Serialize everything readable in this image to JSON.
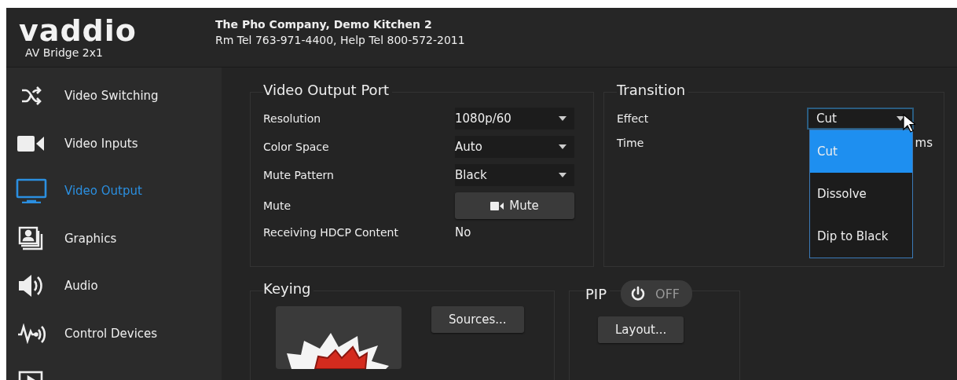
{
  "header": {
    "logo": "vaddio",
    "model": "AV Bridge 2x1",
    "info": [
      "The Pho Company, Demo Kitchen 2",
      "Rm Tel 763-971-4400, Help Tel 800-572-2011"
    ]
  },
  "sidebar": {
    "items": [
      {
        "label": "Video Switching",
        "selected": false
      },
      {
        "label": "Video Inputs",
        "selected": false
      },
      {
        "label": "Video Output",
        "selected": true
      },
      {
        "label": "Graphics",
        "selected": false
      },
      {
        "label": "Audio",
        "selected": false
      },
      {
        "label": "Control Devices",
        "selected": false
      },
      {
        "selected": false
      }
    ]
  },
  "output_port": {
    "title": "Video Output Port",
    "rows": [
      {
        "label": "Resolution",
        "kind": "select",
        "value": "1080p/60"
      },
      {
        "label": "Color Space",
        "kind": "select",
        "value": "Auto"
      },
      {
        "label": "Mute Pattern",
        "kind": "select",
        "value": "Black"
      },
      {
        "label": "Mute",
        "kind": "button",
        "value": "Mute"
      },
      {
        "label": "Receiving HDCP Content",
        "kind": "text",
        "value": "No"
      }
    ]
  },
  "transition": {
    "title": "Transition",
    "effect": {
      "label": "Effect",
      "value": "Cut",
      "open": true,
      "options": [
        {
          "label": "Cut",
          "selected": true
        },
        {
          "label": "Dissolve",
          "selected": false
        },
        {
          "label": "Dip to Black",
          "selected": false
        }
      ]
    },
    "time": {
      "label": "Time",
      "unit": "ms"
    }
  },
  "keying": {
    "title": "Keying",
    "button": "Sources..."
  },
  "pip": {
    "title": "PIP",
    "toggle": {
      "label": "OFF",
      "on": false
    },
    "button": "Layout..."
  }
}
